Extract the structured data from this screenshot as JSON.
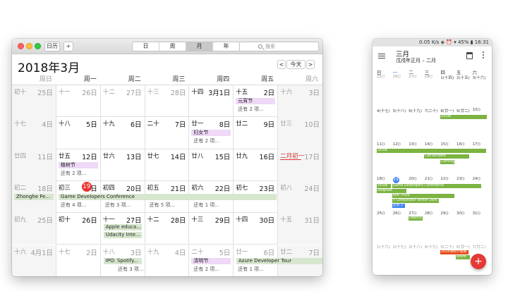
{
  "mac": {
    "toolbar": {
      "calendars_label": "日历",
      "add_label": "+",
      "view_tabs": [
        "日",
        "周",
        "月",
        "年"
      ],
      "active_view": "月",
      "search_placeholder": "搜索"
    },
    "title": "2018年3月",
    "today_button": "今天",
    "prev_label": "<",
    "next_label": ">",
    "weekdays": [
      "周日",
      "周一",
      "周二",
      "周三",
      "周四",
      "周五",
      "周六"
    ],
    "weeks": [
      {
        "cells": [
          {
            "lunar": "初十",
            "day": "25日",
            "dim": true
          },
          {
            "lunar": "十一",
            "day": "26日",
            "dim": true
          },
          {
            "lunar": "十二",
            "day": "27日",
            "dim": true
          },
          {
            "lunar": "十三",
            "day": "28日",
            "dim": true
          },
          {
            "lunar": "十四",
            "day": "3月1日",
            "dim": false
          },
          {
            "lunar": "十五",
            "day": "2日",
            "dim": false
          },
          {
            "lunar": "十六",
            "day": "3日",
            "dim": true
          }
        ]
      },
      {
        "cells": [
          {
            "lunar": "十七",
            "day": "4日",
            "dim": true
          },
          {
            "lunar": "十八",
            "day": "5日",
            "dim": false
          },
          {
            "lunar": "十九",
            "day": "6日",
            "dim": false
          },
          {
            "lunar": "二十",
            "day": "7日",
            "dim": false
          },
          {
            "lunar": "廿一",
            "day": "8日",
            "dim": false
          },
          {
            "lunar": "廿二",
            "day": "9日",
            "dim": false
          },
          {
            "lunar": "廿三",
            "day": "10日",
            "dim": true
          }
        ]
      },
      {
        "cells": [
          {
            "lunar": "廿四",
            "day": "11日",
            "dim": true
          },
          {
            "lunar": "廿五",
            "day": "12日",
            "dim": false
          },
          {
            "lunar": "廿六",
            "day": "13日",
            "dim": false
          },
          {
            "lunar": "廿七",
            "day": "14日",
            "dim": false
          },
          {
            "lunar": "廿八",
            "day": "15日",
            "dim": false
          },
          {
            "lunar": "廿九",
            "day": "16日",
            "dim": false
          },
          {
            "lunar": "二月初一",
            "day": "17日",
            "dim": true
          }
        ]
      },
      {
        "cells": [
          {
            "lunar": "初二",
            "day": "18日",
            "dim": true
          },
          {
            "lunar": "初三",
            "day": "日",
            "dim": false
          },
          {
            "lunar": "初四",
            "day": "20日",
            "dim": false
          },
          {
            "lunar": "初五",
            "day": "21日",
            "dim": false
          },
          {
            "lunar": "初六",
            "day": "22日",
            "dim": false
          },
          {
            "lunar": "初七",
            "day": "23日",
            "dim": false
          },
          {
            "lunar": "初八",
            "day": "24日",
            "dim": true
          }
        ]
      },
      {
        "cells": [
          {
            "lunar": "初九",
            "day": "25日",
            "dim": true
          },
          {
            "lunar": "初十",
            "day": "26日",
            "dim": false
          },
          {
            "lunar": "十一",
            "day": "27日",
            "dim": false
          },
          {
            "lunar": "十二",
            "day": "28日",
            "dim": false
          },
          {
            "lunar": "十三",
            "day": "29日",
            "dim": false
          },
          {
            "lunar": "十四",
            "day": "30日",
            "dim": false
          },
          {
            "lunar": "十五",
            "day": "31日",
            "dim": true
          }
        ]
      },
      {
        "cells": [
          {
            "lunar": "十六",
            "day": "4月1日",
            "dim": true
          },
          {
            "lunar": "十七",
            "day": "2日",
            "dim": true
          },
          {
            "lunar": "十八",
            "day": "3日",
            "dim": true
          },
          {
            "lunar": "十九",
            "day": "4日",
            "dim": true
          },
          {
            "lunar": "二十",
            "day": "5日",
            "dim": true
          },
          {
            "lunar": "廿一",
            "day": "6日",
            "dim": true
          },
          {
            "lunar": "廿二",
            "day": "7日",
            "dim": true
          }
        ]
      }
    ],
    "today_number": "19",
    "events": {
      "yuanxiao": "元宵节",
      "more2a": "还有 2 项...",
      "funvjie": "妇女节",
      "more2b": "还有 2 项...",
      "zhishu": "植树节",
      "more2c": "还有 2 项...",
      "zhonghe": "Zhonghe Fe...",
      "gdc": "Game Developers Conference",
      "more4": "还有 4 项...",
      "more3a": "还有 3 项...",
      "more5": "还有 5 项...",
      "more1a": "还有 1 项...",
      "apple": "Apple educa...",
      "udacity": "Udacity Inte...",
      "ipo": "IPO: Spotify...",
      "qingming": "清明节",
      "azure": "Azure Developer Tour",
      "more3b": "还有 3 项...",
      "more2d": "还有 2 项...",
      "more1b": "还有 1 项..."
    }
  },
  "phone": {
    "status_text": "0.05 K/s  ◈ ⏰ ▾ 45% ▮ 16:31",
    "month_title": "三月",
    "lunar_subtitle": "戊戌年正月 – 二月",
    "weekdays": [
      "日",
      "一",
      "二",
      "三",
      "四",
      "五",
      "六"
    ],
    "weeks": [
      [
        "25()",
        "26()",
        "27()",
        "28()",
        "1(十四)",
        "2(十五)",
        "3(十六)"
      ],
      [
        "4(十七)",
        "5(十八)",
        "6(十九)",
        "7(二十)",
        "8(廿一)",
        "9(廿二)",
        "10()"
      ],
      [
        "11()",
        "12()",
        "13()",
        "14()",
        "15()",
        "16()",
        "17()"
      ],
      [
        "18()",
        "19",
        "20()",
        "21()",
        "22()",
        "23()",
        "24()"
      ],
      [
        "25()",
        "26()",
        "27()",
        "28()",
        "29()",
        "30()",
        "31()"
      ],
      [
        "1(十六)",
        "2(十七)",
        "3(十八)",
        "4(十九)",
        "5(二十)",
        "6(廿一)",
        "7(廿二)"
      ]
    ],
    "events": {
      "sxsw1": "SXSW",
      "sxsw2": "SXSW",
      "cansec": "CanSecWest",
      "coming": "Coming",
      "sxsw3": "SXSW",
      "gdc": "Game Developers Conference",
      "shoptalk": "Shoptalk",
      "ibm": "IBM Think",
      "ycomb": "Y Combinator Winter Dem",
      "more2": "还有 2",
      "udacity": "Udacity",
      "qingming": "2018清明节假期",
      "azure": "Azure"
    },
    "fab_label": "+"
  }
}
